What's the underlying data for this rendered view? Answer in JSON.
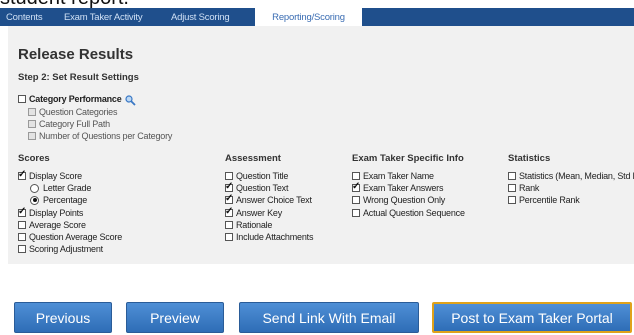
{
  "page_heading_fragment": "student report.",
  "tabs": [
    {
      "label": "Contents"
    },
    {
      "label": "Exam Taker Activity"
    },
    {
      "label": "Adjust Scoring"
    },
    {
      "label": "Reporting/Scoring",
      "active": true
    }
  ],
  "release": {
    "title": "Release Results",
    "step": "Step 2: Set Result Settings"
  },
  "category": {
    "label": "Category Performance",
    "checked": false,
    "sub_options": [
      "Question Categories",
      "Category Full Path",
      "Number of Questions per Category"
    ]
  },
  "scores": {
    "heading": "Scores",
    "display_score": "Display Score",
    "letter_grade": "Letter Grade",
    "percentage": "Percentage",
    "display_points": "Display Points",
    "average_score": "Average Score",
    "question_average_score": "Question Average Score",
    "scoring_adjustment": "Scoring Adjustment"
  },
  "assessment": {
    "heading": "Assessment",
    "items": [
      {
        "label": "Question Title",
        "checked": false
      },
      {
        "label": "Question Text",
        "checked": true
      },
      {
        "label": "Answer Choice Text",
        "checked": true
      },
      {
        "label": "Answer Key",
        "checked": true
      },
      {
        "label": "Rationale",
        "checked": false
      },
      {
        "label": "Include Attachments",
        "checked": false
      }
    ]
  },
  "exam_taker_info": {
    "heading": "Exam Taker Specific Info",
    "items": [
      {
        "label": "Exam Taker Name",
        "checked": false
      },
      {
        "label": "Exam Taker Answers",
        "checked": true
      },
      {
        "label": "Wrong Question Only",
        "checked": false
      },
      {
        "label": "Actual Question Sequence",
        "checked": false
      }
    ]
  },
  "statistics": {
    "heading": "Statistics",
    "items": [
      {
        "label": "Statistics (Mean, Median, Std Dev",
        "checked": false
      },
      {
        "label": "Rank",
        "checked": false
      },
      {
        "label": "Percentile Rank",
        "checked": false
      }
    ]
  },
  "buttons": {
    "previous": "Previous",
    "preview": "Preview",
    "send_link": "Send Link With Email",
    "post_portal": "Post to Exam Taker Portal"
  },
  "colors": {
    "tab_bar": "#1f4f8c",
    "button_blue": "#3a7cc7",
    "highlight_border": "#e0a21a"
  }
}
